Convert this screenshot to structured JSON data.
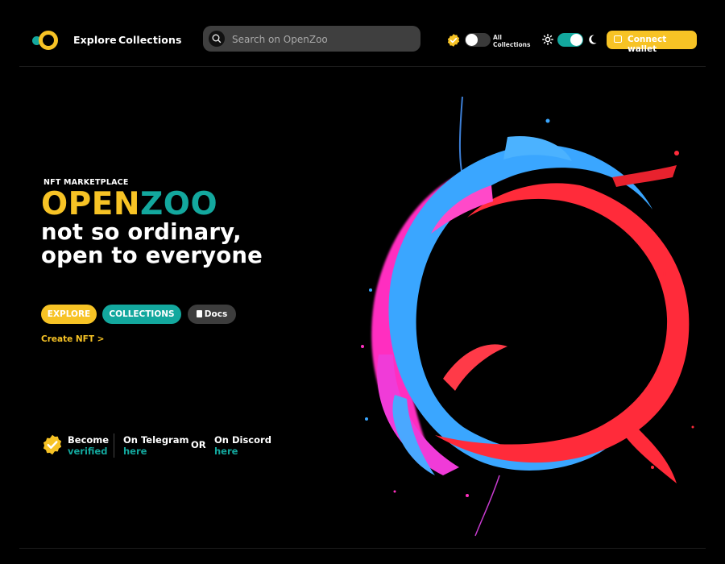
{
  "nav": {
    "explore": "Explore",
    "collections": "Collections"
  },
  "search": {
    "placeholder": "Search on OpenZoo"
  },
  "controls": {
    "all_collections_line1": "All",
    "all_collections_line2": "Collections",
    "connect_wallet": "Connect wallet"
  },
  "hero": {
    "eyebrow": "NFT MARKETPLACE",
    "brand_part1": "OPEN",
    "brand_part2": "ZOO",
    "tagline_line1": "not so ordinary,",
    "tagline_line2": "open to everyone",
    "explore_button": "EXPLORE",
    "collections_button": "COLLECTIONS",
    "docs_button": "Docs",
    "create_nft": "Create NFT >"
  },
  "footer": {
    "verified_line1": "Become",
    "verified_line2": "verified",
    "telegram_line1": "On Telegram",
    "telegram_line2": "here",
    "or": "OR",
    "discord_line1": "On Discord",
    "discord_line2": "here"
  },
  "colors": {
    "accent_yellow": "#f7c325",
    "accent_teal": "#13a89e",
    "background": "#000000",
    "search_bg": "#3f3f3f",
    "docs_bg": "#3d3d3d"
  },
  "icons": {
    "logo": "openzoo-logo",
    "search": "search-icon",
    "verified": "verified-badge-icon",
    "sun": "sun-icon",
    "moon": "moon-icon",
    "wallet": "wallet-icon",
    "book": "book-icon"
  },
  "state": {
    "all_collections_toggle": "off",
    "dark_mode_toggle": "on"
  }
}
